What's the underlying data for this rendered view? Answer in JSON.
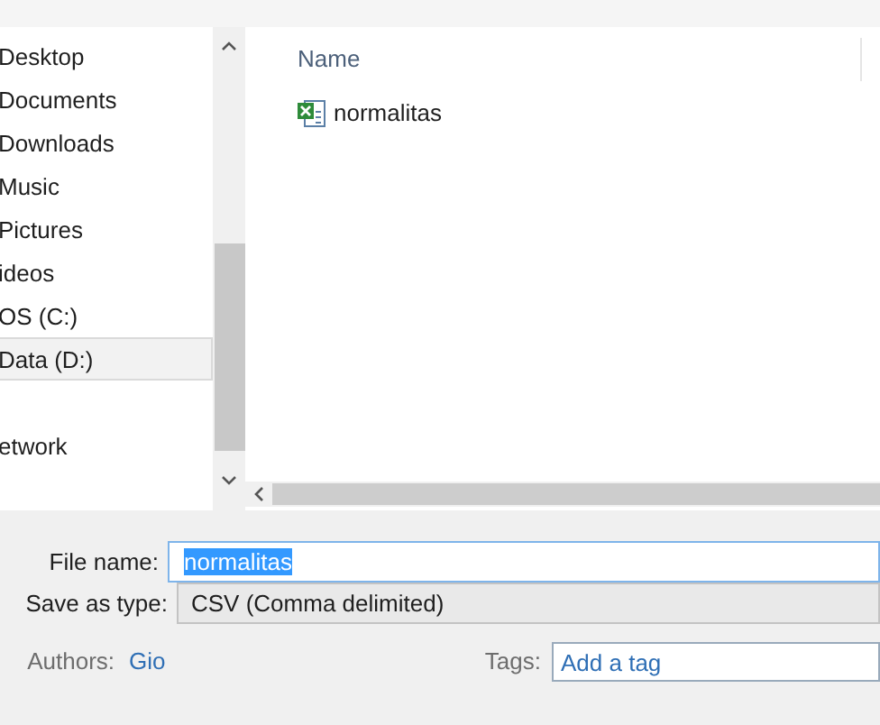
{
  "nav_pane": {
    "items": [
      {
        "label": "Desktop",
        "selected": false
      },
      {
        "label": "Documents",
        "selected": false
      },
      {
        "label": "Downloads",
        "selected": false
      },
      {
        "label": "Music",
        "selected": false
      },
      {
        "label": "Pictures",
        "selected": false
      },
      {
        "label": "ideos",
        "selected": false
      },
      {
        "label": "OS (C:)",
        "selected": false
      },
      {
        "label": "Data (D:)",
        "selected": true
      },
      {
        "label": "etwork",
        "selected": false,
        "gap_before": true
      }
    ]
  },
  "file_list": {
    "columns": [
      "Name"
    ],
    "rows": [
      {
        "name": "normalitas",
        "selected": false
      }
    ]
  },
  "file_name": {
    "label": "File name:",
    "value": "normalitas"
  },
  "save_as_type": {
    "label": "Save as type:",
    "value": "CSV (Comma delimited)"
  },
  "authors": {
    "label": "Authors:",
    "value": "Gio"
  },
  "tags": {
    "label": "Tags:",
    "placeholder": "Add a tag"
  }
}
